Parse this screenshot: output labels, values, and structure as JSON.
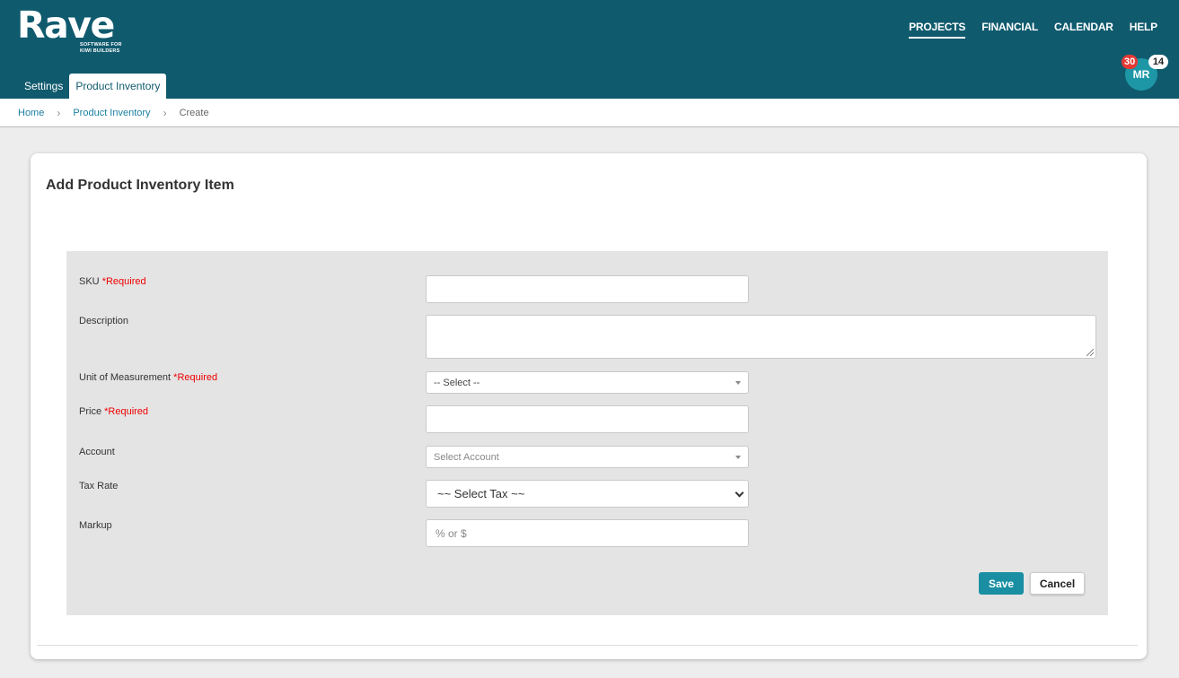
{
  "brand": {
    "name": "Rave",
    "tagline": "SOFTWARE FOR KIWI BUILDERS"
  },
  "topnav": [
    "PROJECTS",
    "FINANCIAL",
    "CALENDAR",
    "HELP"
  ],
  "user": {
    "initials": "MR",
    "badge_red": "30",
    "badge_white": "14"
  },
  "subtabs": [
    "Settings",
    "Product Inventory"
  ],
  "breadcrumb": {
    "home": "Home",
    "section": "Product Inventory",
    "current": "Create"
  },
  "form": {
    "title": "Add Product Inventory Item",
    "required_text": "*Required",
    "sku_label": "SKU",
    "description_label": "Description",
    "uom_label": "Unit of Measurement",
    "uom_value": "-- Select --",
    "price_label": "Price",
    "account_label": "Account",
    "account_placeholder": "Select Account",
    "tax_label": "Tax Rate",
    "tax_value": "~~ Select Tax ~~",
    "markup_label": "Markup",
    "markup_placeholder": "% or $",
    "save_label": "Save",
    "cancel_label": "Cancel"
  },
  "colors": {
    "header": "#105a6e",
    "accent": "#1a8fa3",
    "required": "#e00000",
    "badge": "#e53935"
  }
}
